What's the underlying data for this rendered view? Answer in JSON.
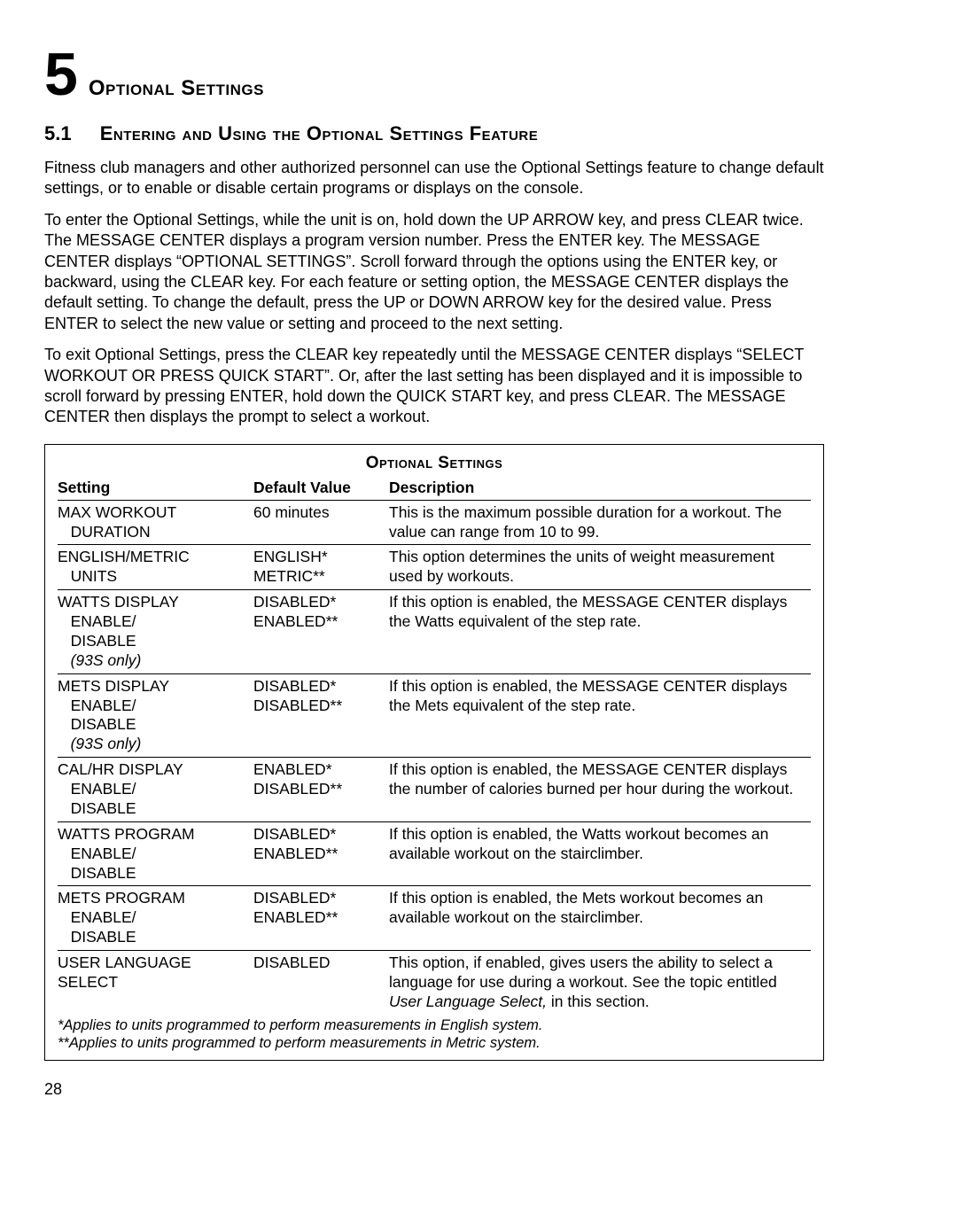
{
  "chapter": {
    "number": "5",
    "title": "Optional Settings"
  },
  "section": {
    "number": "5.1",
    "title": "Entering and Using the Optional Settings Feature"
  },
  "paragraphs": {
    "p1": "Fitness club managers and other authorized personnel can use the Optional Settings feature to change default settings, or to enable or disable certain programs or displays on the console.",
    "p2": "To enter the Optional Settings, while the unit is on, hold down the UP ARROW key, and press CLEAR twice. The MESSAGE CENTER displays a program version number. Press the ENTER key. The MESSAGE CENTER displays “OPTIONAL SETTINGS”. Scroll forward through the options using the ENTER key, or backward, using the CLEAR key. For each feature or setting option, the MESSAGE CENTER displays the default setting. To change the default, press the UP or DOWN ARROW key for the desired value. Press ENTER to select the new value or setting and proceed to the next setting.",
    "p3": "To exit Optional Settings, press the CLEAR key repeatedly until the MESSAGE CENTER displays “SELECT WORKOUT OR PRESS QUICK START”. Or, after the last setting has been displayed and it is impossible to scroll forward by pressing ENTER, hold down the QUICK START key, and press CLEAR. The MESSAGE CENTER then displays the prompt to select a workout."
  },
  "table": {
    "title": "Optional Settings",
    "headers": {
      "setting": "Setting",
      "default": "Default Value",
      "description": "Description"
    },
    "rows": [
      {
        "s1": "MAX WORKOUT",
        "s2": "   DURATION",
        "s3": "",
        "s4": "",
        "d1": "60 minutes",
        "d2": "",
        "desc": "This is the maximum possible duration for a workout. The value can range from 10 to 99."
      },
      {
        "s1": "ENGLISH/METRIC",
        "s2": "   UNITS",
        "s3": "",
        "s4": "",
        "d1": "ENGLISH*",
        "d2": "METRIC**",
        "desc": "This option determines the units of weight measurement used by workouts."
      },
      {
        "s1": "WATTS DISPLAY",
        "s2": "   ENABLE/",
        "s3": "   DISABLE",
        "s4": "   (93S only)",
        "s4_italic": true,
        "d1": "DISABLED*",
        "d2": "ENABLED**",
        "desc": "If this option is enabled, the MESSAGE CENTER displays the Watts equivalent of the step rate."
      },
      {
        "s1": "METS DISPLAY",
        "s2": "   ENABLE/",
        "s3": "   DISABLE",
        "s4": "   (93S only)",
        "s4_italic": true,
        "d1": "DISABLED*",
        "d2": "DISABLED**",
        "desc": "If this option is enabled, the MESSAGE CENTER displays the Mets equivalent of the step rate."
      },
      {
        "s1": "CAL/HR DISPLAY",
        "s2": "   ENABLE/",
        "s3": "   DISABLE",
        "s4": "",
        "d1": "ENABLED*",
        "d2": "DISABLED**",
        "desc": "If this option is enabled, the MESSAGE CENTER displays the number of calories burned per hour during the workout."
      },
      {
        "s1": "WATTS PROGRAM",
        "s2": "   ENABLE/",
        "s3": "   DISABLE",
        "s4": "",
        "d1": "DISABLED*",
        "d2": "ENABLED**",
        "desc": "If this option is enabled, the Watts workout becomes an available workout on the stairclimber."
      },
      {
        "s1": "METS PROGRAM",
        "s2": "   ENABLE/",
        "s3": "   DISABLE",
        "s4": "",
        "d1": "DISABLED*",
        "d2": "ENABLED**",
        "desc": "If this option is enabled, the Mets workout becomes an available workout on the stairclimber."
      },
      {
        "s1": "USER LANGUAGE SELECT",
        "s2": "",
        "s3": "",
        "s4": "",
        "d1": "DISABLED",
        "d2": "",
        "desc_pre": "This option, if enabled, gives users the ability to select a language for use during a workout. See the topic entitled ",
        "desc_ital": "User Language Select,",
        "desc_post": " in this section."
      }
    ]
  },
  "footnotes": {
    "f1": "*Applies to units programmed to perform measurements in English system.",
    "f2": "**Applies to units programmed to perform measurements in Metric system."
  },
  "page_number": "28"
}
